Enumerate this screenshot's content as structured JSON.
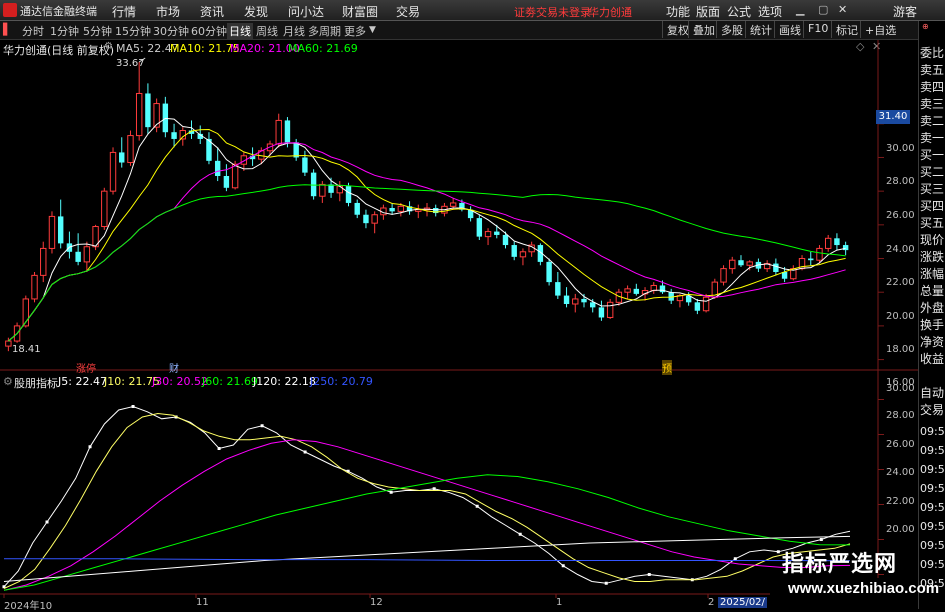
{
  "titlebar": {
    "app_title": "通达信金融终端",
    "menu": [
      "行情",
      "市场",
      "资讯",
      "发现",
      "问小达",
      "财富圈",
      "交易"
    ],
    "notice": "证劵交易未登录",
    "stock_name": "华力创通",
    "right_menu": [
      "功能",
      "版面",
      "公式",
      "选项"
    ],
    "user": "游客"
  },
  "toolbar": {
    "periods": [
      "分时",
      "1分钟",
      "5分钟",
      "15分钟",
      "30分钟",
      "60分钟",
      "日线",
      "周线",
      "月线",
      "多周期",
      "更多"
    ],
    "active_period": "日线",
    "buttons": [
      "复权",
      "叠加",
      "多股",
      "统计",
      "画线",
      "F10",
      "标记",
      "+自选"
    ]
  },
  "main_chart": {
    "title": "华力创通(日线 前复权)",
    "ma": [
      {
        "label": "MA5: 22.47",
        "color": "#ffffff"
      },
      {
        "label": "MA10: 21.75",
        "color": "#ffff00"
      },
      {
        "label": "MA20: 21.00",
        "color": "#ff00ff"
      },
      {
        "label": "MA60: 21.69",
        "color": "#00ff00"
      }
    ],
    "high_label": "33.67",
    "low_label": "18.41",
    "current_price": "31.40",
    "y_ticks": [
      "30.00",
      "28.00",
      "26.00",
      "24.00",
      "22.00",
      "20.00",
      "18.00",
      "16.00"
    ],
    "markers": [
      {
        "text": "涨停",
        "color": "#ff4040"
      },
      {
        "text": "财",
        "color": "#8fb4ff"
      },
      {
        "text": "预",
        "color": "#ffcc00"
      }
    ]
  },
  "indicator": {
    "title": "股朋指标",
    "lines": [
      {
        "label": "J5: 22.47",
        "color": "#ffffff"
      },
      {
        "label": "J10: 21.75",
        "color": "#ffff66"
      },
      {
        "label": "J30: 20.52",
        "color": "#ff00ff"
      },
      {
        "label": "J60: 21.69",
        "color": "#00ff00"
      },
      {
        "label": "J120: 22.18",
        "color": "#ffffff"
      },
      {
        "label": "J250: 20.79",
        "color": "#3355ff"
      }
    ],
    "y_ticks": [
      "30.00",
      "28.00",
      "26.00",
      "24.00",
      "22.00",
      "20.00"
    ]
  },
  "x_axis": [
    "2024年10",
    "11",
    "12",
    "1",
    "2",
    "2025/02/"
  ],
  "right_panel": {
    "items": [
      "委比",
      "卖五",
      "卖四",
      "卖三",
      "卖二",
      "卖一",
      "买一",
      "买二",
      "买三",
      "买四",
      "买五",
      "现价",
      "涨跌",
      "涨幅",
      "总量",
      "外盘",
      "换手",
      "净资",
      "收益"
    ],
    "bottom_labels": [
      "自动",
      "交易"
    ],
    "times": [
      "09:52",
      "09:52",
      "09:52",
      "09:52",
      "09:52",
      "09:53",
      "09:53",
      "09:53",
      "09:53"
    ]
  },
  "watermark": {
    "line1": "指标严选网",
    "line2": "www.xuezhibiao.com"
  },
  "chart_data": [
    {
      "type": "candlestick",
      "title": "华力创通(日线 前复权)",
      "ylim": [
        15.5,
        34.5
      ],
      "candles": [
        [
          16.8,
          17.3,
          16.5,
          17.1
        ],
        [
          17.1,
          18.2,
          17.0,
          18.0
        ],
        [
          18.0,
          19.8,
          17.9,
          19.6
        ],
        [
          19.6,
          21.2,
          19.4,
          21.0
        ],
        [
          21.0,
          23.0,
          20.6,
          22.6
        ],
        [
          22.6,
          24.8,
          22.3,
          24.5
        ],
        [
          24.5,
          25.5,
          22.6,
          22.9
        ],
        [
          22.9,
          23.6,
          22.0,
          22.4
        ],
        [
          22.4,
          23.5,
          21.6,
          21.8
        ],
        [
          21.8,
          23.0,
          21.2,
          22.7
        ],
        [
          22.7,
          24.0,
          22.5,
          23.9
        ],
        [
          23.9,
          26.2,
          23.7,
          26.0
        ],
        [
          26.0,
          28.6,
          25.8,
          28.3
        ],
        [
          28.3,
          29.2,
          27.4,
          27.7
        ],
        [
          27.7,
          29.6,
          27.5,
          29.3
        ],
        [
          29.3,
          33.67,
          29.0,
          31.8
        ],
        [
          31.8,
          32.4,
          29.4,
          29.8
        ],
        [
          29.8,
          31.5,
          29.5,
          31.2
        ],
        [
          31.2,
          31.6,
          29.2,
          29.5
        ],
        [
          29.5,
          30.0,
          28.6,
          29.1
        ],
        [
          29.1,
          29.8,
          28.7,
          29.6
        ],
        [
          29.6,
          30.2,
          29.1,
          29.4
        ],
        [
          29.4,
          29.9,
          28.8,
          29.1
        ],
        [
          29.1,
          29.5,
          27.6,
          27.8
        ],
        [
          27.8,
          28.6,
          26.6,
          26.9
        ],
        [
          26.9,
          27.6,
          26.0,
          26.2
        ],
        [
          26.2,
          27.8,
          26.1,
          27.6
        ],
        [
          27.6,
          28.3,
          27.2,
          28.1
        ],
        [
          28.1,
          28.6,
          27.5,
          27.9
        ],
        [
          27.9,
          28.6,
          27.6,
          28.4
        ],
        [
          28.4,
          29.0,
          28.1,
          28.8
        ],
        [
          28.8,
          30.6,
          28.6,
          30.2
        ],
        [
          30.2,
          30.4,
          28.6,
          28.9
        ],
        [
          28.9,
          29.1,
          27.8,
          28.0
        ],
        [
          28.0,
          28.4,
          26.9,
          27.1
        ],
        [
          27.1,
          27.3,
          25.5,
          25.7
        ],
        [
          25.7,
          26.6,
          25.3,
          26.4
        ],
        [
          26.4,
          26.8,
          25.6,
          25.9
        ],
        [
          25.9,
          26.6,
          25.4,
          26.3
        ],
        [
          26.3,
          26.5,
          25.1,
          25.3
        ],
        [
          25.3,
          25.5,
          24.4,
          24.6
        ],
        [
          24.6,
          24.9,
          23.8,
          24.1
        ],
        [
          24.1,
          24.8,
          23.5,
          24.6
        ],
        [
          24.6,
          25.2,
          24.3,
          25.0
        ],
        [
          25.0,
          25.3,
          24.6,
          24.8
        ],
        [
          24.8,
          25.3,
          24.5,
          25.1
        ],
        [
          25.1,
          25.4,
          24.6,
          24.8
        ],
        [
          24.8,
          25.2,
          24.4,
          24.9
        ],
        [
          24.9,
          25.3,
          24.5,
          25.0
        ],
        [
          25.0,
          25.2,
          24.5,
          24.7
        ],
        [
          24.7,
          25.3,
          24.5,
          25.1
        ],
        [
          25.1,
          25.6,
          24.9,
          25.3
        ],
        [
          25.3,
          25.5,
          24.8,
          24.9
        ],
        [
          24.9,
          25.1,
          24.2,
          24.4
        ],
        [
          24.4,
          24.6,
          23.1,
          23.3
        ],
        [
          23.3,
          23.8,
          22.8,
          23.6
        ],
        [
          23.6,
          24.0,
          23.2,
          23.4
        ],
        [
          23.4,
          23.6,
          22.6,
          22.8
        ],
        [
          22.8,
          23.0,
          21.9,
          22.1
        ],
        [
          22.1,
          22.6,
          21.6,
          22.4
        ],
        [
          22.4,
          23.0,
          22.1,
          22.8
        ],
        [
          22.8,
          22.9,
          21.6,
          21.8
        ],
        [
          21.8,
          22.0,
          20.4,
          20.6
        ],
        [
          20.6,
          21.2,
          19.6,
          19.8
        ],
        [
          19.8,
          20.3,
          19.1,
          19.3
        ],
        [
          19.3,
          19.9,
          18.8,
          19.6
        ],
        [
          19.6,
          19.9,
          19.1,
          19.4
        ],
        [
          19.4,
          19.6,
          18.8,
          19.1
        ],
        [
          19.1,
          19.5,
          18.3,
          18.5
        ],
        [
          18.5,
          19.6,
          18.41,
          19.4
        ],
        [
          19.4,
          20.2,
          19.2,
          20.0
        ],
        [
          20.0,
          20.4,
          19.6,
          20.2
        ],
        [
          20.2,
          20.5,
          19.8,
          19.9
        ],
        [
          19.9,
          20.3,
          19.5,
          20.1
        ],
        [
          20.1,
          20.6,
          19.9,
          20.4
        ],
        [
          20.4,
          20.7,
          19.9,
          20.0
        ],
        [
          20.0,
          20.2,
          19.3,
          19.5
        ],
        [
          19.5,
          19.9,
          19.1,
          19.8
        ],
        [
          19.8,
          20.0,
          19.2,
          19.4
        ],
        [
          19.4,
          19.6,
          18.7,
          18.9
        ],
        [
          18.9,
          19.9,
          18.8,
          19.7
        ],
        [
          19.7,
          20.8,
          19.6,
          20.6
        ],
        [
          20.6,
          21.6,
          20.4,
          21.4
        ],
        [
          21.4,
          22.1,
          21.1,
          21.9
        ],
        [
          21.9,
          22.2,
          21.5,
          21.6
        ],
        [
          21.6,
          21.9,
          21.3,
          21.8
        ],
        [
          21.8,
          22.0,
          21.2,
          21.4
        ],
        [
          21.4,
          21.9,
          21.2,
          21.7
        ],
        [
          21.7,
          22.0,
          21.0,
          21.2
        ],
        [
          21.2,
          21.5,
          20.6,
          20.8
        ],
        [
          20.8,
          21.6,
          20.7,
          21.4
        ],
        [
          21.4,
          22.2,
          21.3,
          22.0
        ],
        [
          22.0,
          22.4,
          21.6,
          21.9
        ],
        [
          21.9,
          22.8,
          21.7,
          22.6
        ],
        [
          22.6,
          23.4,
          22.4,
          23.2
        ],
        [
          23.2,
          23.5,
          22.5,
          22.8
        ],
        [
          22.8,
          23.0,
          22.2,
          22.5
        ]
      ],
      "moving_averages": [
        "MA5",
        "MA10",
        "MA20",
        "MA60"
      ],
      "ma_colors": [
        "#ffffff",
        "#ffff00",
        "#ff00ff",
        "#00ff00"
      ]
    },
    {
      "type": "line",
      "title": "股朋指标",
      "ylim": [
        19.0,
        31.0
      ],
      "series": [
        {
          "name": "J5",
          "color": "#ffffff",
          "values": [
            19.3,
            20.2,
            21.8,
            23.0,
            24.2,
            25.5,
            27.3,
            28.6,
            29.4,
            29.6,
            29.3,
            28.9,
            29.0,
            28.7,
            28.1,
            27.2,
            27.4,
            28.3,
            28.5,
            28.1,
            27.4,
            27.0,
            26.6,
            26.2,
            25.9,
            25.5,
            25.0,
            24.7,
            24.8,
            24.8,
            24.9,
            24.7,
            24.4,
            23.9,
            23.3,
            22.8,
            22.3,
            21.8,
            21.2,
            20.5,
            20.0,
            19.6,
            19.5,
            19.7,
            19.9,
            20.0,
            19.9,
            19.8,
            19.7,
            19.9,
            20.3,
            20.9,
            21.3,
            21.4,
            21.3,
            21.5,
            21.8,
            22.0,
            22.3,
            22.47
          ]
        },
        {
          "name": "J10",
          "color": "#ffff66",
          "values": [
            19.2,
            19.6,
            20.3,
            21.5,
            22.8,
            24.3,
            25.9,
            27.3,
            28.4,
            29.0,
            29.2,
            29.1,
            28.7,
            28.2,
            27.9,
            27.7,
            27.7,
            27.8,
            27.9,
            27.7,
            27.3,
            26.7,
            26.0,
            25.5,
            25.2,
            25.0,
            24.9,
            24.8,
            24.8,
            24.8,
            24.6,
            24.1,
            23.6,
            23.2,
            22.7,
            22.1,
            21.5,
            20.9,
            20.4,
            20.1,
            19.8,
            19.6,
            19.6,
            19.7,
            19.7,
            19.7,
            19.8,
            19.9,
            20.2,
            20.6,
            21.0,
            21.2,
            21.3,
            21.4,
            21.5,
            21.75
          ]
        },
        {
          "name": "J30",
          "color": "#ff00ff",
          "values": [
            19.1,
            19.4,
            19.9,
            20.5,
            21.3,
            22.2,
            23.2,
            24.2,
            25.1,
            25.9,
            26.6,
            27.1,
            27.5,
            27.7,
            27.6,
            27.3,
            26.9,
            26.5,
            26.1,
            25.7,
            25.3,
            24.9,
            24.5,
            24.1,
            23.7,
            23.3,
            22.9,
            22.5,
            22.1,
            21.7,
            21.3,
            21.0,
            20.8,
            20.6,
            20.5,
            20.4,
            20.4,
            20.5,
            20.52
          ]
        },
        {
          "name": "J60",
          "color": "#00ff00",
          "values": [
            19.1,
            19.4,
            19.9,
            20.4,
            20.9,
            21.4,
            21.9,
            22.4,
            22.9,
            23.4,
            23.8,
            24.2,
            24.6,
            24.9,
            25.2,
            25.5,
            25.7,
            25.6,
            25.3,
            24.9,
            24.4,
            23.8,
            23.3,
            22.9,
            22.5,
            22.2,
            21.9,
            21.7,
            21.69
          ]
        },
        {
          "name": "J120",
          "color": "#ffffff",
          "values": [
            19.6,
            19.9,
            20.2,
            20.5,
            20.8,
            21.0,
            21.2,
            21.4,
            21.6,
            21.8,
            21.9,
            22.0,
            22.1,
            22.18
          ]
        },
        {
          "name": "J250",
          "color": "#3355ff",
          "values": [
            20.9,
            20.9,
            20.85,
            20.85,
            20.8,
            20.8,
            20.8,
            20.79
          ]
        }
      ]
    }
  ]
}
